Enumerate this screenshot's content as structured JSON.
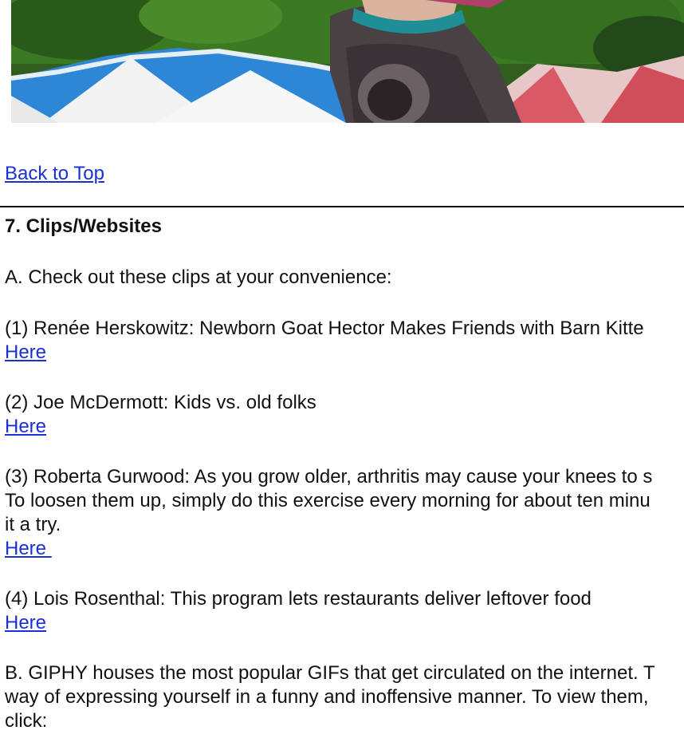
{
  "back_to_top": "Back to Top",
  "section": {
    "title": "7. Clips/Websites",
    "intro": "A. Check out these clips at your convenience:",
    "clips": [
      {
        "lines": [
          "(1) Renée Herskowitz: Newborn Goat Hector Makes Friends with Barn Kitte"
        ],
        "link": "Here"
      },
      {
        "lines": [
          "(2) Joe McDermott: Kids vs. old folks"
        ],
        "link": "Here"
      },
      {
        "lines": [
          "(3) Roberta Gurwood: As you grow older, arthritis may cause your knees to s",
          "To loosen them up, simply do this exercise every morning for about ten minu",
          "it a try."
        ],
        "link": "Here "
      },
      {
        "lines": [
          "(4) Lois Rosenthal: This program lets restaurants deliver leftover food"
        ],
        "link": "Here"
      }
    ],
    "giphy_lines": [
      "B. GIPHY houses the most popular GIFs that get circulated on the internet. T",
      "way of expressing yourself in a funny and inoffensive manner. To view them,",
      "click:"
    ]
  },
  "colors": {
    "link": "#1a2fd6",
    "text": "#111111"
  }
}
